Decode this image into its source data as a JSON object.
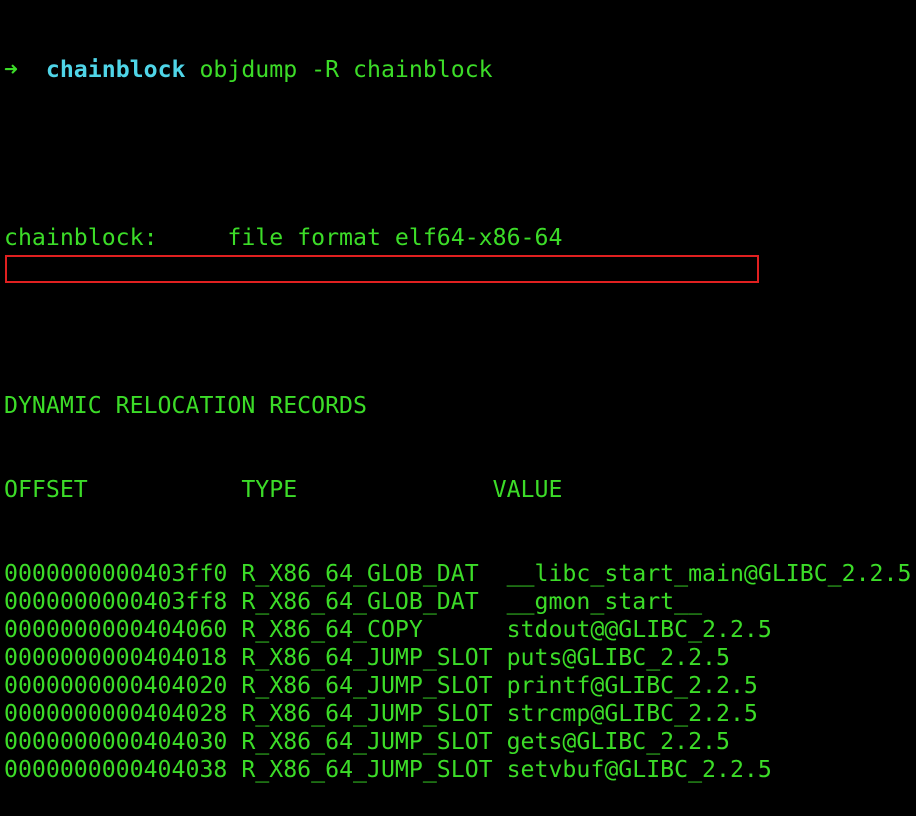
{
  "terminal": {
    "prompt": {
      "arrow": "➜",
      "directory": "chainblock",
      "command": "objdump -R chainblock"
    },
    "file_line": {
      "name": "chainblock:",
      "format": "file format elf64-x86-64"
    },
    "section_title": "DYNAMIC RELOCATION RECORDS",
    "columns": {
      "offset": "OFFSET",
      "type": "TYPE",
      "value": "VALUE"
    },
    "records": [
      {
        "offset": "0000000000403ff0",
        "type": "R_X86_64_GLOB_DAT",
        "value": "__libc_start_main@GLIBC_2.2.5"
      },
      {
        "offset": "0000000000403ff8",
        "type": "R_X86_64_GLOB_DAT",
        "value": "__gmon_start__"
      },
      {
        "offset": "0000000000404060",
        "type": "R_X86_64_COPY",
        "value": "stdout@@GLIBC_2.2.5"
      },
      {
        "offset": "0000000000404018",
        "type": "R_X86_64_JUMP_SLOT",
        "value": "puts@GLIBC_2.2.5"
      },
      {
        "offset": "0000000000404020",
        "type": "R_X86_64_JUMP_SLOT",
        "value": "printf@GLIBC_2.2.5"
      },
      {
        "offset": "0000000000404028",
        "type": "R_X86_64_JUMP_SLOT",
        "value": "strcmp@GLIBC_2.2.5"
      },
      {
        "offset": "0000000000404030",
        "type": "R_X86_64_JUMP_SLOT",
        "value": "gets@GLIBC_2.2.5"
      },
      {
        "offset": "0000000000404038",
        "type": "R_X86_64_JUMP_SLOT",
        "value": "setvbuf@GLIBC_2.2.5"
      }
    ],
    "highlighted_record_index": 3,
    "colors": {
      "background": "#000000",
      "text": "#3cdc28",
      "prompt_directory": "#4fd5e8",
      "highlight_border": "#e02020"
    }
  }
}
